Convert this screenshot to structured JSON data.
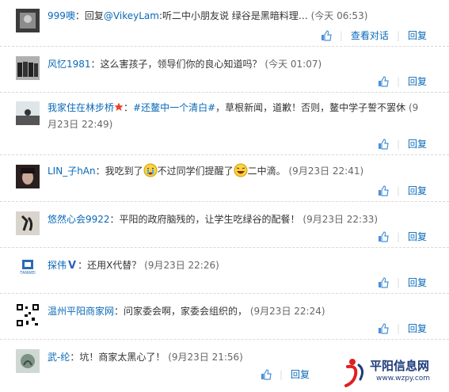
{
  "comments": [
    {
      "user": "999噢",
      "text_prefix": "：回复",
      "mention": "@VikeyLam",
      "text": ":听二中小朋友说 绿谷是黑暗料理…",
      "time": "(今天 06:53)",
      "view_convo": "查看对话",
      "reply": "回复"
    },
    {
      "user": "风忆1981",
      "text": "：这么害孩子，领导们你的良心知道吗？",
      "time": "(今天 01:07)",
      "reply": "回复"
    },
    {
      "user": "我家住在林步桥",
      "topic": "#还鳌中一个清白#",
      "text": "，草根新闻，道歉！否则，鳌中学子誓不罢休",
      "time": "(9月23日 22:49)",
      "reply": "回复"
    },
    {
      "user": "LIN_子hAn",
      "text_a": "：我吃到了",
      "text_b": "不过同学们提醒了",
      "text_c": "二中滴。",
      "time": "(9月23日 22:41)",
      "reply": "回复"
    },
    {
      "user": "悠然心会9922",
      "text": "：平阳的政府脑残的，让学生吃绿谷的配餐！",
      "time": "(9月23日 22:33)",
      "reply": "回复"
    },
    {
      "user": "探伟",
      "badge": "V",
      "text": "：还用X代替？",
      "time": "(9月23日 22:26)",
      "reply": "回复",
      "avatar_text": "TANWEI"
    },
    {
      "user": "温州平阳商家网",
      "text": "：问家委会啊，家委会组织的，",
      "time": "(9月23日 22:24)",
      "reply": "回复"
    },
    {
      "user": "武-纶",
      "text": "：坑！商家太黑心了！",
      "time": "(9月23日 21:56)",
      "reply": "回复"
    }
  ],
  "watermark": {
    "title": "平阳信息网",
    "url": "www.wzpy.com"
  }
}
